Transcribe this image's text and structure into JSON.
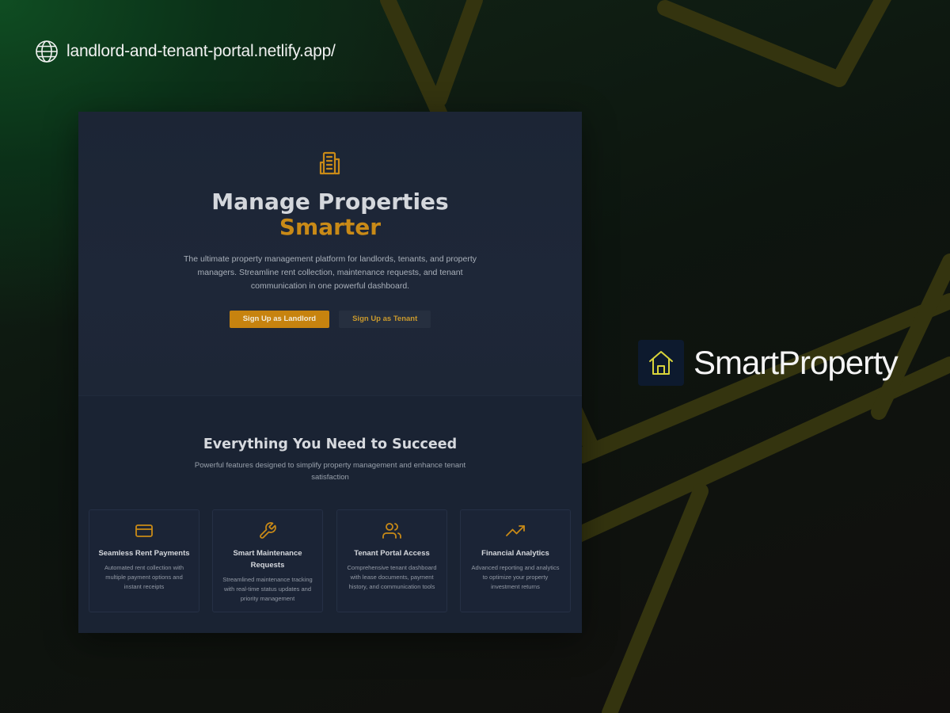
{
  "url": "landlord-and-tenant-portal.netlify.app/",
  "hero": {
    "title": "Manage Properties",
    "title_accent": "Smarter",
    "description": "The ultimate property management platform for landlords, tenants, and property managers. Streamline rent collection, maintenance requests, and tenant communication in one powerful dashboard.",
    "primary_button": "Sign Up as Landlord",
    "secondary_button": "Sign Up as Tenant"
  },
  "features": {
    "title": "Everything You Need to Succeed",
    "subtitle": "Powerful features designed to simplify property management and enhance tenant satisfaction",
    "cards": [
      {
        "icon": "credit-card-icon",
        "title": "Seamless Rent Payments",
        "description": "Automated rent collection with multiple payment options and instant receipts"
      },
      {
        "icon": "wrench-icon",
        "title": "Smart Maintenance Requests",
        "description": "Streamlined maintenance tracking with real-time status updates and priority management"
      },
      {
        "icon": "users-icon",
        "title": "Tenant Portal Access",
        "description": "Comprehensive tenant dashboard with lease documents, payment history, and communication tools"
      },
      {
        "icon": "trending-up-icon",
        "title": "Financial Analytics",
        "description": "Advanced reporting and analytics to optimize your property investment returns"
      }
    ]
  },
  "brand": {
    "name": "SmartProperty",
    "icon": "house-icon"
  },
  "colors": {
    "accent": "#c7830f",
    "brand_icon": "#d9d43a",
    "background_line": "#3a3a12"
  }
}
